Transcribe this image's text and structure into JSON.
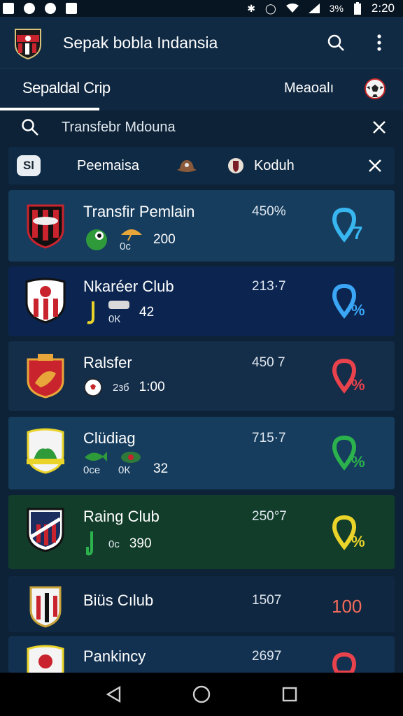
{
  "status_bar": {
    "time": "2:20",
    "battery": "3%"
  },
  "app_bar": {
    "title": "Sepak bobla Indansia"
  },
  "tabs": {
    "left_label": "Sepaldal Crip",
    "right_label": "Meaoalı"
  },
  "search": {
    "query": "Transfebr Mdouna"
  },
  "filter": {
    "badge": "Sl",
    "chip1": "Peemaisa",
    "chip2": "Koduh"
  },
  "cards": [
    {
      "name": "Transfir Pemlain",
      "score": "450%",
      "mini_a": "0с",
      "mini_b": "",
      "value": "200",
      "indicator_color": "#38b6f0",
      "indicator_glyph": "%"
    },
    {
      "name": "Nkaréer Club",
      "score": "213·7",
      "mini_a": "",
      "mini_b": "0К",
      "value": "42",
      "indicator_color": "#3aa6f5",
      "indicator_glyph": "%"
    },
    {
      "name": "Ralsfer",
      "score": "450 7",
      "mini_a": "2зб",
      "mini_b": "",
      "value": "1:00",
      "indicator_color": "#e8424c",
      "indicator_glyph": "%"
    },
    {
      "name": "Clüdiag",
      "score": "715·7",
      "mini_a": "0сe",
      "mini_b": "0К",
      "value": "32",
      "indicator_color": "#2bb24c",
      "indicator_glyph": "%"
    },
    {
      "name": "Raing Club",
      "score": "250°7",
      "mini_a": "0с",
      "mini_b": "",
      "value": "390",
      "indicator_color": "#ebd42a",
      "indicator_glyph": "%"
    },
    {
      "name": "Biüs Cılub",
      "score": "1507",
      "big_value": "100"
    },
    {
      "name": "Pankincy",
      "score": "2697",
      "indicator_color": "#e8424c"
    }
  ]
}
